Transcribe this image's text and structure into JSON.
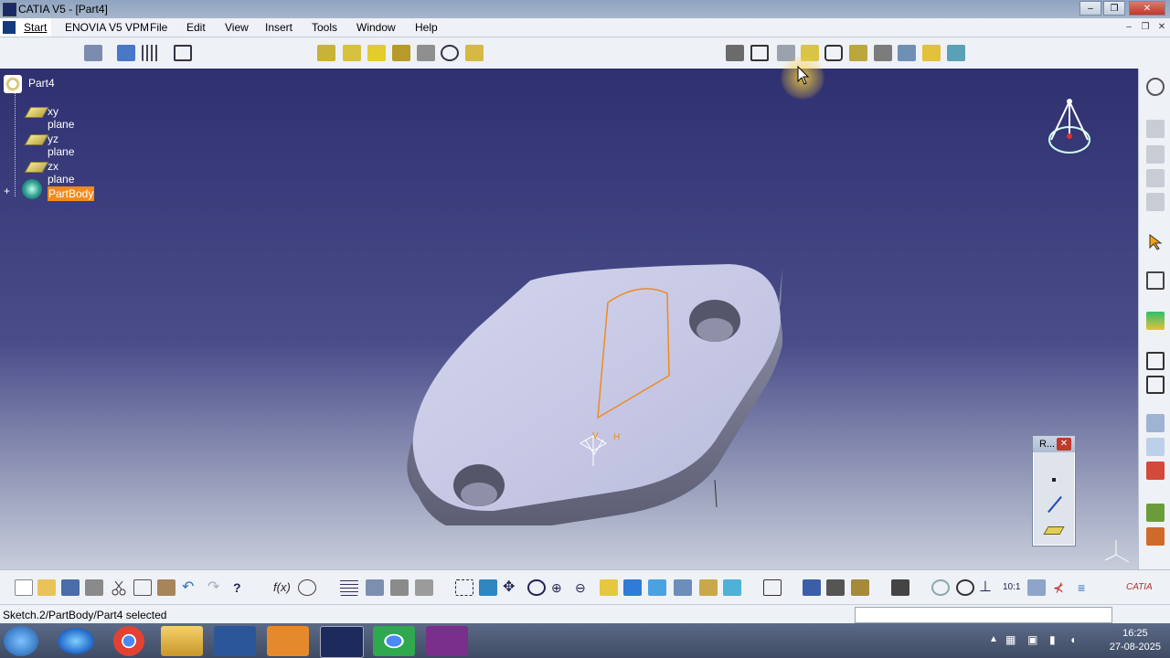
{
  "window": {
    "title": "CATIA V5 - [Part4]",
    "minimize": "–",
    "restore": "❐",
    "close": "✕"
  },
  "menu": {
    "start": "Start",
    "items": [
      "ENOVIA V5 VPM",
      "File",
      "Edit",
      "View",
      "Insert",
      "Tools",
      "Window",
      "Help"
    ]
  },
  "tree": {
    "root": "Part4",
    "planes": [
      "xy plane",
      "yz plane",
      "zx plane"
    ],
    "body": "PartBody"
  },
  "sketch_axes": {
    "v_label": "V",
    "h_label": "H"
  },
  "mini_window": {
    "title": "R...",
    "close": "✕"
  },
  "status": {
    "message": "Sketch.2/PartBody/Part4 selected"
  },
  "taskbar": {
    "time": "16:25",
    "date": "27-08-2025"
  },
  "colors": {
    "accent_selection": "#f28a1c",
    "viewport_top": "#2e3070",
    "part_face": "#c9cbe8"
  },
  "icons": {
    "top_toolbar": [
      "lock-icon",
      "workbench-icon",
      "grid-icon",
      "snap-icon",
      "pad-icon",
      "pocket-icon",
      "shaft-icon",
      "groove-icon",
      "hole-icon",
      "rib-icon",
      "slot-icon",
      "sketch-icon",
      "positioned-sketch-icon",
      "constraint-icon",
      "fillet-icon",
      "chamfer-icon",
      "draft-icon",
      "shell-icon",
      "thickness-icon",
      "thread-icon",
      "measure-icon"
    ],
    "bottom_toolbar": [
      "new-icon",
      "open-icon",
      "save-icon",
      "print-icon",
      "cut-icon",
      "copy-icon",
      "paste-icon",
      "undo-icon",
      "redo-icon",
      "whats-this-icon",
      "formula-icon",
      "comment-icon",
      "table-icon",
      "tools-palette-icon",
      "catalog-icon",
      "analysis-icon",
      "fit-all-icon",
      "pan-icon",
      "rotate-icon",
      "zoom-in-icon",
      "zoom-out-icon",
      "normal-view-icon",
      "iso-view-icon",
      "render-style-icon",
      "hide-show-icon",
      "swap-icon",
      "capture-icon",
      "3d-compass-icon"
    ]
  }
}
